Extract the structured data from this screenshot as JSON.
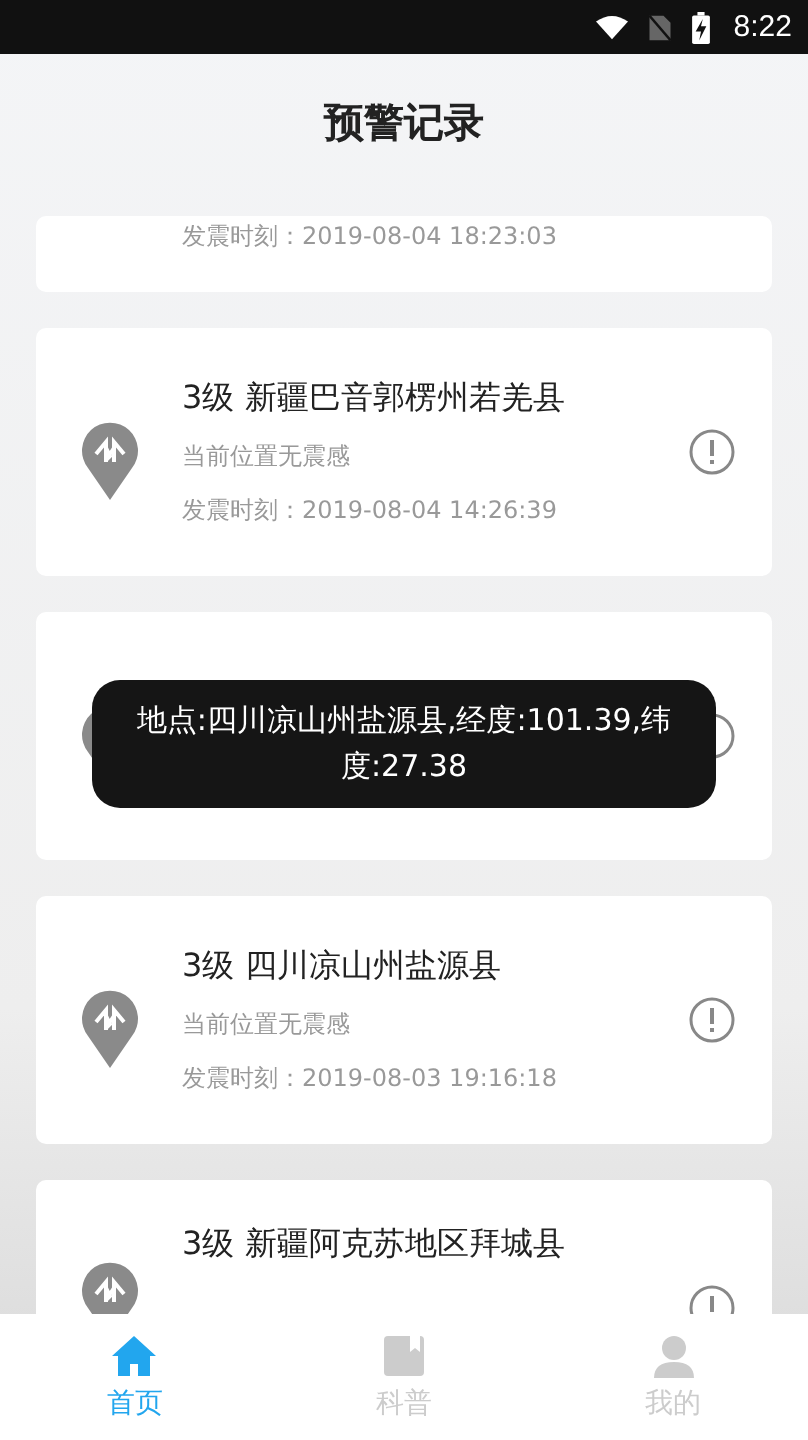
{
  "status_bar": {
    "time": "8:22"
  },
  "header": {
    "title": "预警记录"
  },
  "records": [
    {
      "kind": "partial",
      "time": "发震时刻：2019-08-04 18:23:03"
    },
    {
      "kind": "full",
      "title": "3级 新疆巴音郭楞州若羌县",
      "subtitle": "当前位置无震感",
      "time": "发震时刻：2019-08-04 14:26:39"
    },
    {
      "kind": "full"
    },
    {
      "kind": "full",
      "title": "3级 四川凉山州盐源县",
      "subtitle": "当前位置无震感",
      "time": "发震时刻：2019-08-03 19:16:18"
    },
    {
      "kind": "full",
      "title": "3级 新疆阿克苏地区拜城县"
    }
  ],
  "toast": {
    "text": "地点:四川凉山州盐源县,经度:101.39,纬度:27.38"
  },
  "tabs": [
    {
      "label": "首页",
      "selected": true
    },
    {
      "label": "科普",
      "selected": false
    },
    {
      "label": "我的",
      "selected": false
    }
  ]
}
